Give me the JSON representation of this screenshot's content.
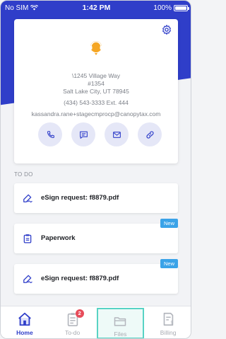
{
  "status_bar": {
    "carrier": "No SIM",
    "time": "1:42 PM",
    "battery": "100%"
  },
  "contact": {
    "address_line1": "\\1245 Village Way",
    "address_line2": "#1354",
    "address_line3": "Salt Lake City, UT 78945",
    "phone": "(434) 543-3333 Ext. 444",
    "email": "kassandra.rane+stagecmprocp@canopytax.com"
  },
  "todo": {
    "section_label": "TO DO",
    "items": [
      {
        "title": "eSign request: f8879.pdf",
        "icon": "signature-icon",
        "badge": ""
      },
      {
        "title": "Paperwork",
        "icon": "clipboard-icon",
        "badge": "New"
      },
      {
        "title": "eSign request: f8879.pdf",
        "icon": "signature-icon",
        "badge": "New"
      }
    ]
  },
  "tabs": [
    {
      "label": "Home",
      "icon": "home-icon",
      "active": true
    },
    {
      "label": "To-do",
      "icon": "clipboard-list-icon",
      "badge": "2"
    },
    {
      "label": "Files",
      "icon": "folder-icon",
      "highlighted": true
    },
    {
      "label": "Billing",
      "icon": "invoice-icon"
    }
  ],
  "colors": {
    "brand_blue": "#2f3ec9",
    "accent_orange": "#f5a623",
    "new_badge": "#3aa3e8",
    "count_badge": "#e74c5a",
    "highlight_teal": "#58d3c4"
  }
}
